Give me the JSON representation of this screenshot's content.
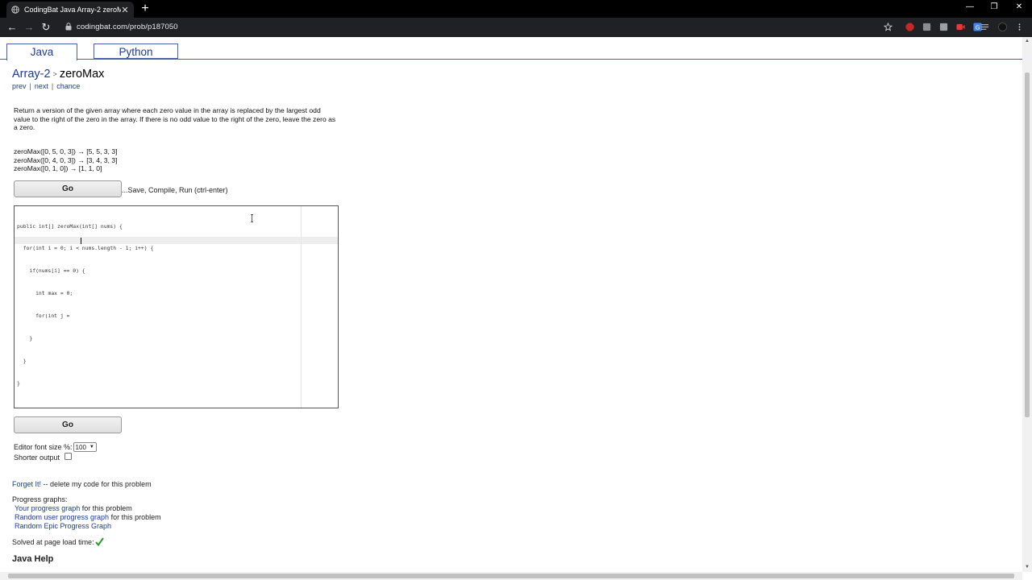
{
  "browser": {
    "tab_title": "CodingBat Java Array-2 zeroMax",
    "tab_close": "✕",
    "new_tab": "+",
    "url": "codingbat.com/prob/p187050",
    "nav": {
      "back": "←",
      "forward": "→",
      "reload": "↻"
    },
    "window": {
      "minimize": "—",
      "restore": "❐",
      "close": "✕"
    }
  },
  "lang_tabs": [
    {
      "label": "Java"
    },
    {
      "label": "Python"
    }
  ],
  "breadcrumb": {
    "section": "Array-2",
    "separator": ">",
    "problem": "zeroMax"
  },
  "problem_nav": {
    "prev": "prev",
    "next": "next",
    "chance": "chance",
    "sep": "|"
  },
  "description": "Return a version of the given array where each zero value in the array is replaced by the largest odd value to the right of the zero in the array. If there is no odd value to the right of the zero, leave the zero as a zero.",
  "examples": [
    "zeroMax([0, 5, 0, 3]) → [5, 5, 3, 3]",
    "zeroMax([0, 4, 0, 3]) → [3, 4, 3, 3]",
    "zeroMax([0, 1, 0]) → [1, 1, 0]"
  ],
  "go_label": "Go",
  "go_hint": "...Save, Compile, Run (ctrl-enter)",
  "code_lines": [
    "public int[] zeroMax(int[] nums) {",
    "  for(int i = 0; i < nums.length - 1; i++) {",
    "    if(nums[i] == 0) {",
    "      int max = 0;",
    "      for(int j = ",
    "    }",
    "  }",
    "}"
  ],
  "font_size": {
    "label": "Editor font size %:",
    "value": "100"
  },
  "shorter_output": {
    "label": "Shorter output"
  },
  "forget": {
    "link": "Forget It!",
    "text": " -- delete my code for this problem"
  },
  "progress": {
    "title": "Progress graphs:",
    "items": [
      {
        "link": "Your progress graph",
        "text": " for this problem"
      },
      {
        "link": "Random user progress graph",
        "text": " for this problem"
      },
      {
        "link": "Random Epic Progress Graph",
        "text": ""
      }
    ]
  },
  "solved": "Solved at page load time:",
  "java_help": "Java Help",
  "colors": {
    "link": "#1a3b9b",
    "chrome": "#202124",
    "check": "#2a9a2a"
  }
}
